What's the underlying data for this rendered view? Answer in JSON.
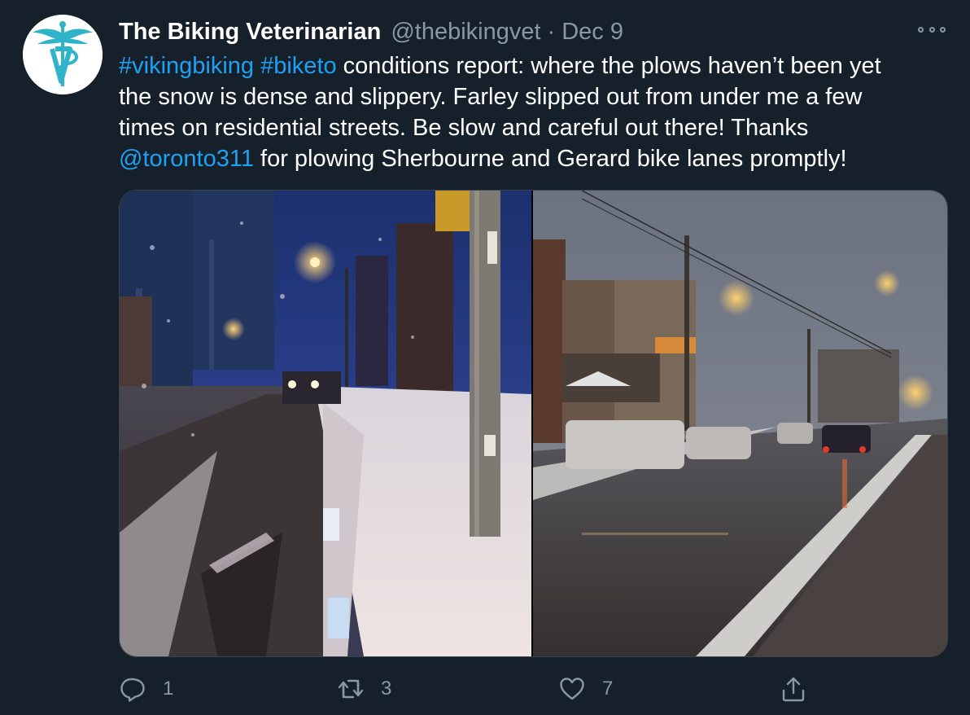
{
  "author": {
    "display_name": "The Biking Veterinarian",
    "handle": "@thebikingvet",
    "separator": "·",
    "date": "Dec 9",
    "avatar_icon": "caduceus-vet-logo-icon"
  },
  "tweet": {
    "lines": [
      [
        {
          "text": "#vikingbiking",
          "link": true
        },
        {
          "text": " ",
          "link": false
        },
        {
          "text": "#biketo",
          "link": true
        },
        {
          "text": " conditions report: where the plows haven’t been yet",
          "link": false
        }
      ],
      [
        {
          "text": "the snow is dense and slippery. Farley slipped out from under me a few",
          "link": false
        }
      ],
      [
        {
          "text": "times on residential streets. Be slow and careful out there! Thanks",
          "link": false
        }
      ],
      [
        {
          "text": "@toronto311",
          "link": true
        },
        {
          "text": " for plowing Sherbourne and Gerard bike lanes promptly!",
          "link": false
        }
      ]
    ]
  },
  "media": {
    "photos": [
      {
        "name": "photo-snowy-sidewalk-night"
      },
      {
        "name": "photo-snowy-street-dusk"
      }
    ]
  },
  "actions": {
    "reply": {
      "icon": "reply-icon",
      "count": "1"
    },
    "retweet": {
      "icon": "retweet-icon",
      "count": "3"
    },
    "like": {
      "icon": "heart-icon",
      "count": "7"
    },
    "share": {
      "icon": "share-icon"
    }
  },
  "colors": {
    "background": "#15202b",
    "text": "#ffffff",
    "secondary": "#8899a6",
    "link": "#1da1f2",
    "avatar_logo": "#2fb3c8"
  }
}
